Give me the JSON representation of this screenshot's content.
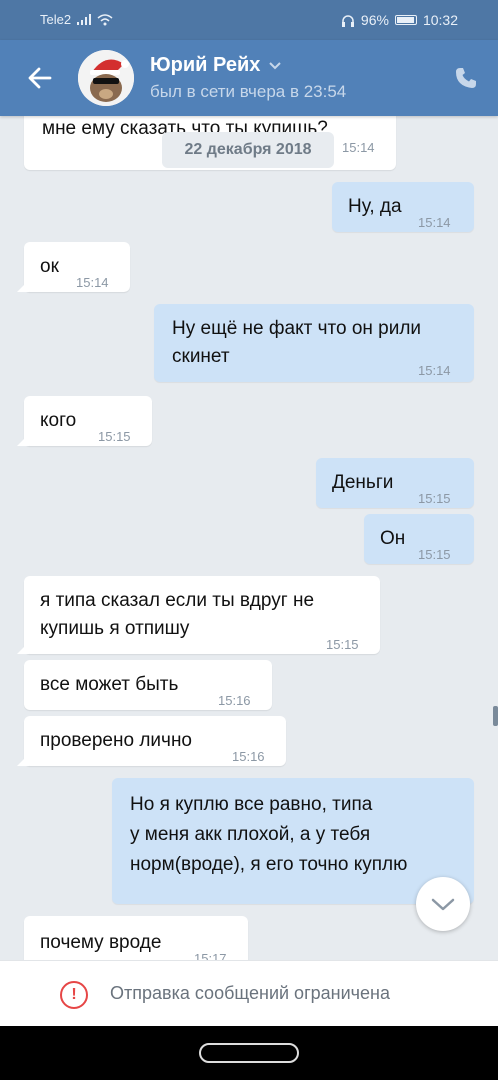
{
  "status_bar": {
    "carrier": "Tele2",
    "battery": "96%",
    "clock": "10:32"
  },
  "header": {
    "name": "Юрий Рейх",
    "last_seen": "был в сети вчера в 23:54"
  },
  "date_divider": "22 декабря 2018",
  "messages": [
    {
      "dir": "in",
      "text": "мне ему сказать что ты купишь?",
      "time": "15:14"
    },
    {
      "dir": "out",
      "text": "Ну, да",
      "time": "15:14"
    },
    {
      "dir": "in",
      "text": "ок",
      "time": "15:14"
    },
    {
      "dir": "out",
      "text1": "Ну ещё не факт что он рили",
      "text2": "скинет",
      "time": "15:14"
    },
    {
      "dir": "in",
      "text": "кого",
      "time": "15:15"
    },
    {
      "dir": "out",
      "text": "Деньги",
      "time": "15:15"
    },
    {
      "dir": "out",
      "text": "Он",
      "time": "15:15"
    },
    {
      "dir": "in",
      "text1": "я типа сказал если ты вдруг не",
      "text2": "купишь я отпишу",
      "time": "15:15"
    },
    {
      "dir": "in",
      "text": "все может быть",
      "time": "15:16"
    },
    {
      "dir": "in",
      "text": "проверено лично",
      "time": "15:16"
    },
    {
      "dir": "out",
      "text1": "Но я куплю все равно, типа",
      "text2": "у меня акк плохой, а у тебя",
      "text3": "норм(вроде), я его точно куплю"
    },
    {
      "dir": "in",
      "text": "почему вроде",
      "time": "15:17"
    }
  ],
  "restriction_notice": "Отправка сообщений ограничена",
  "icons": {
    "back": "arrow-left-icon",
    "call": "phone-icon",
    "scroll_down": "chevron-down-icon",
    "warning": "exclamation-circle-icon"
  },
  "colors": {
    "header": "#5181b8",
    "outgoing_bubble": "#cde2f7",
    "incoming_bubble": "#ffffff",
    "warning": "#e64646"
  }
}
